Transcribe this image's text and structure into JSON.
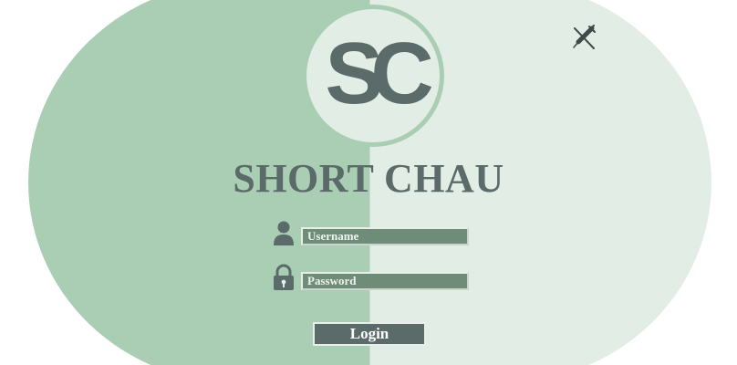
{
  "brand": {
    "logo_letters": "SC",
    "title": "SHORT CHAU"
  },
  "login_form": {
    "username_placeholder": "Username",
    "username_value": "",
    "password_placeholder": "Password",
    "password_value": "",
    "login_label": "Login"
  },
  "icons": {
    "user": "user-icon",
    "lock": "lock-icon",
    "close": "syringe-close-icon"
  },
  "colors": {
    "left_panel": "#a9ceb3",
    "right_panel": "#e2ede5",
    "accent_dark": "#5b6b69",
    "field_fill": "#6f8c78"
  }
}
